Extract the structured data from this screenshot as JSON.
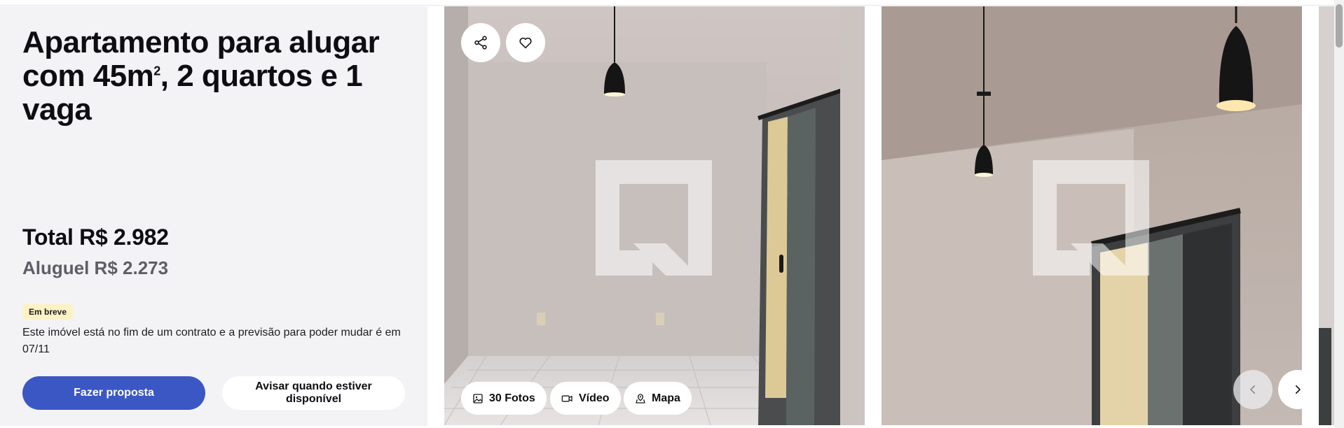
{
  "listing": {
    "title_main": "Apartamento para alugar com 45m",
    "title_sup": "2",
    "title_rest": ", 2 quartos e 1 vaga",
    "total_price": "Total R$ 2.982",
    "rent_price": "Aluguel R$ 2.273",
    "badge": "Em breve",
    "notice": "Este imóvel está no fim de um contrato e a previsão para poder mudar é em 07/11"
  },
  "actions": {
    "primary_label": "Fazer proposta",
    "secondary_label": "Avisar quando estiver disponível"
  },
  "gallery": {
    "photos_label": "30 Fotos",
    "video_label": "Vídeo",
    "map_label": "Mapa",
    "icons": [
      "share-icon",
      "heart-icon",
      "photos-icon",
      "video-icon",
      "map-icon",
      "chevron-left-icon",
      "chevron-right-icon"
    ]
  },
  "colors": {
    "primary_button": "#3b57c4",
    "badge_background": "#fdf2c5",
    "panel_background": "#f3f3f6"
  }
}
